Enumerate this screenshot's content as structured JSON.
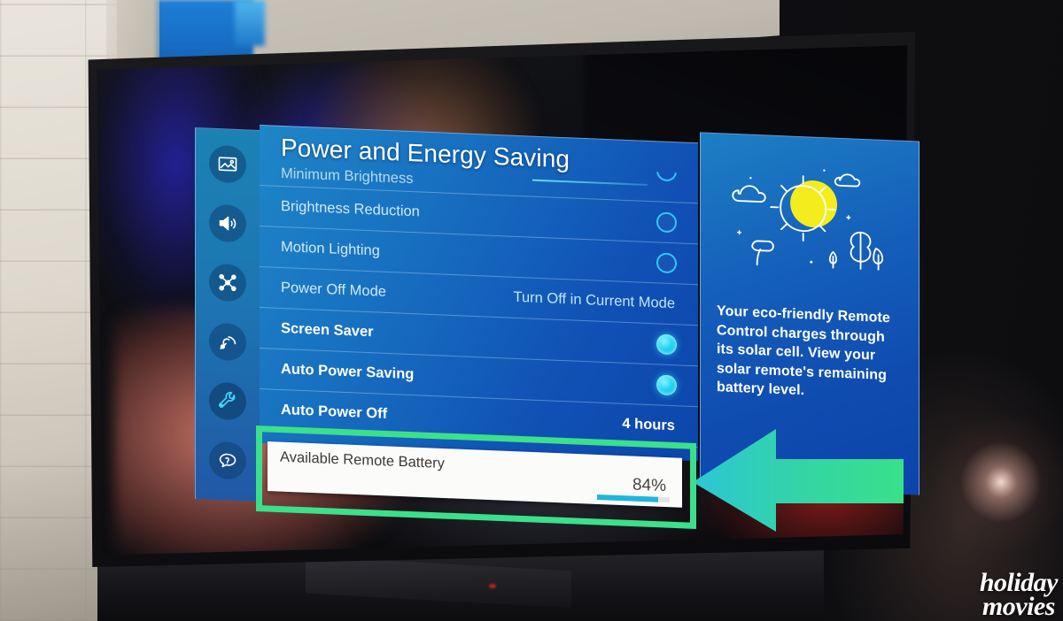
{
  "scene": {
    "description": "Photo of a Samsung TV displaying the Power and Energy Saving settings menu, with a green highlight box and arrow callout",
    "watermark_line1": "holiday",
    "watermark_line2": "movies"
  },
  "colors": {
    "panel_blue_light": "#1f86c7",
    "panel_blue_dark": "#0c46ab",
    "sidebar_blue": "#1b82b4",
    "accent_cyan": "#2fc8f5",
    "toggle_on": "#22d6f5",
    "highlight_green": "#3ce08a",
    "arrow_green": "#36df8a",
    "arrow_cyan": "#2ec8d8",
    "sun_yellow": "#f5ec1e",
    "card_white": "#fbfbfa",
    "battery_bar": "#1fb6dc"
  },
  "sidebar": {
    "items": [
      {
        "id": "picture",
        "icon": "picture-icon",
        "label": "Picture",
        "selected": false
      },
      {
        "id": "sound",
        "icon": "sound-icon",
        "label": "Sound",
        "selected": false
      },
      {
        "id": "connection",
        "icon": "connection-icon",
        "label": "Connection",
        "selected": false
      },
      {
        "id": "broadcast",
        "icon": "broadcast-icon",
        "label": "Broadcast",
        "selected": false
      },
      {
        "id": "general",
        "icon": "wrench-icon",
        "label": "General",
        "selected": true
      },
      {
        "id": "support",
        "icon": "help-icon",
        "label": "Support",
        "selected": false
      }
    ]
  },
  "menu": {
    "title": "Power and Energy Saving",
    "rows": [
      {
        "label": "Minimum Brightness",
        "value": "",
        "control": "toggle-off-clipped",
        "clipped": true,
        "strong": false
      },
      {
        "label": "Brightness Reduction",
        "value": "",
        "control": "toggle-off",
        "clipped": false,
        "strong": false
      },
      {
        "label": "Motion Lighting",
        "value": "",
        "control": "toggle-off",
        "clipped": false,
        "strong": false
      },
      {
        "label": "Power Off Mode",
        "value": "Turn Off in Current Mode",
        "control": "value",
        "clipped": false,
        "strong": false
      },
      {
        "label": "Screen Saver",
        "value": "",
        "control": "toggle-on",
        "clipped": false,
        "strong": true
      },
      {
        "label": "Auto Power Saving",
        "value": "",
        "control": "toggle-on",
        "clipped": false,
        "strong": true
      },
      {
        "label": "Auto Power Off",
        "value": "4 hours",
        "control": "value",
        "clipped": false,
        "strong": true
      }
    ]
  },
  "info_panel": {
    "illustration": "sun-clouds-trees-illustration",
    "text": "Your eco-friendly Remote Control charges through its solar cell. View your solar remote's remaining battery level."
  },
  "battery_card": {
    "label": "Available Remote Battery",
    "percent_text": "84%",
    "percent_value": 84
  },
  "callout": {
    "arrow": "left-pointing-arrow",
    "highlight": "green-rectangle-highlight"
  }
}
